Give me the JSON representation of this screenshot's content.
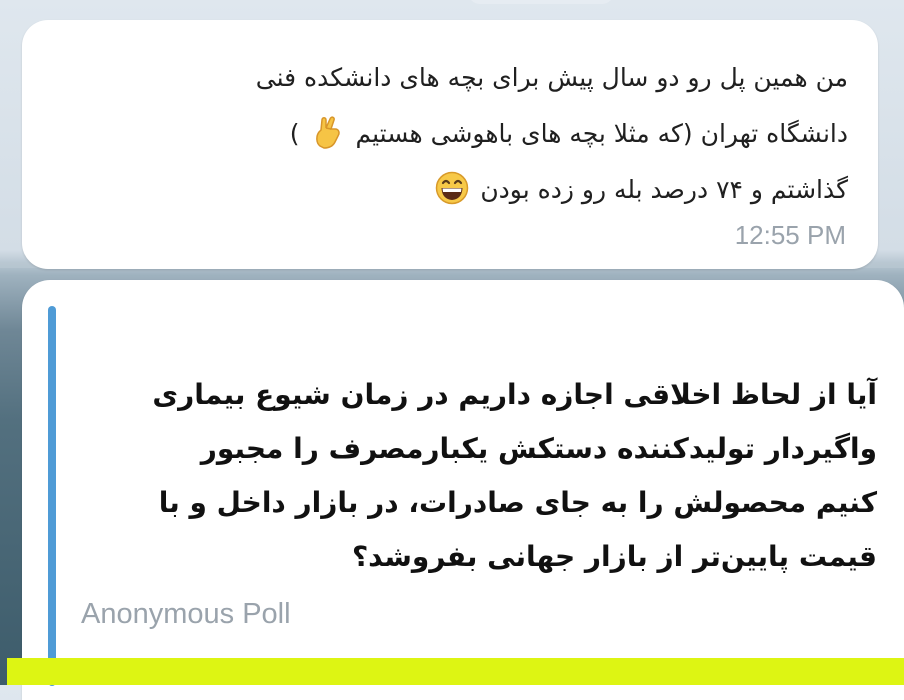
{
  "message1": {
    "line1": "من همین پل رو دو سال پیش برای بچه های دانشکده فنی",
    "line2_a": "دانشگاه تهران (که مثلا بچه های باهوشی هستیم",
    "line2_b": ")",
    "line3": "گذاشتم و ۷۴ درصد بله رو زده بودن",
    "emoji1": "crossed-fingers",
    "emoji2": "grinning-face",
    "time": "12:55 PM"
  },
  "poll": {
    "question_lines": [
      "آیا از لحاظ اخلاقی اجازه داریم در زمان شیوع بیماری",
      "واگیردار تولیدکننده دستکش یکبارمصرف را مجبور",
      "کنیم محصولش را به جای صادرات، در بازار داخل و با",
      "قیمت پایین‌تر از بازار جهانی بفروشد؟"
    ],
    "type_label": "Anonymous Poll",
    "accent_color": "#4f9bd6"
  },
  "colors": {
    "bottom_band": "#ddf513"
  }
}
